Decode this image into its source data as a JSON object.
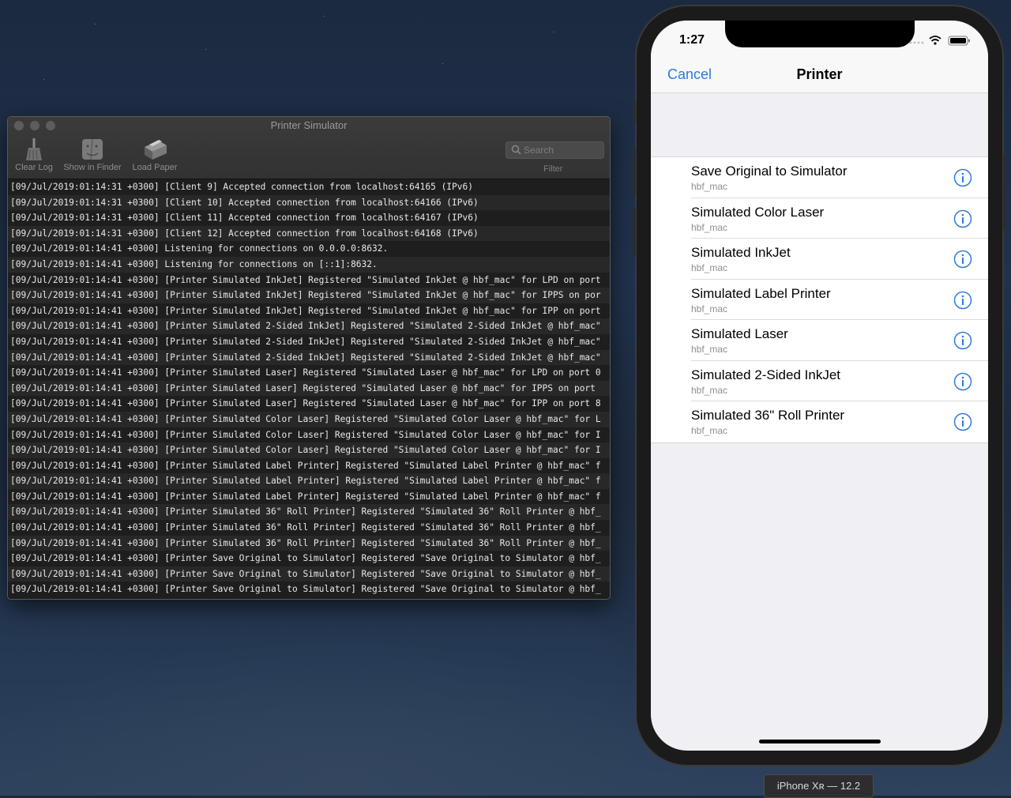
{
  "mac_window": {
    "title": "Printer Simulator",
    "toolbar": {
      "clear_log": "Clear Log",
      "show_in_finder": "Show in Finder",
      "load_paper": "Load Paper",
      "search_placeholder": "Search",
      "filter_label": "Filter"
    },
    "log_lines": [
      "[09/Jul/2019:01:14:31 +0300] [Client 9] Accepted connection from localhost:64165 (IPv6)",
      "[09/Jul/2019:01:14:31 +0300] [Client 10] Accepted connection from localhost:64166 (IPv6)",
      "[09/Jul/2019:01:14:31 +0300] [Client 11] Accepted connection from localhost:64167 (IPv6)",
      "[09/Jul/2019:01:14:31 +0300] [Client 12] Accepted connection from localhost:64168 (IPv6)",
      "[09/Jul/2019:01:14:41 +0300] Listening for connections on 0.0.0.0:8632.",
      "[09/Jul/2019:01:14:41 +0300] Listening for connections on [::1]:8632.",
      "[09/Jul/2019:01:14:41 +0300] [Printer Simulated InkJet] Registered \"Simulated InkJet @ hbf_mac\" for LPD on port",
      "[09/Jul/2019:01:14:41 +0300] [Printer Simulated InkJet] Registered \"Simulated InkJet @ hbf_mac\" for IPPS on por",
      "[09/Jul/2019:01:14:41 +0300] [Printer Simulated InkJet] Registered \"Simulated InkJet @ hbf_mac\" for IPP on port",
      "[09/Jul/2019:01:14:41 +0300] [Printer Simulated 2-Sided InkJet] Registered \"Simulated 2-Sided InkJet @ hbf_mac\"",
      "[09/Jul/2019:01:14:41 +0300] [Printer Simulated 2-Sided InkJet] Registered \"Simulated 2-Sided InkJet @ hbf_mac\"",
      "[09/Jul/2019:01:14:41 +0300] [Printer Simulated 2-Sided InkJet] Registered \"Simulated 2-Sided InkJet @ hbf_mac\"",
      "[09/Jul/2019:01:14:41 +0300] [Printer Simulated Laser] Registered \"Simulated Laser @ hbf_mac\" for LPD on port 0",
      "[09/Jul/2019:01:14:41 +0300] [Printer Simulated Laser] Registered \"Simulated Laser @ hbf_mac\" for IPPS on port",
      "[09/Jul/2019:01:14:41 +0300] [Printer Simulated Laser] Registered \"Simulated Laser @ hbf_mac\" for IPP on port 8",
      "[09/Jul/2019:01:14:41 +0300] [Printer Simulated Color Laser] Registered \"Simulated Color Laser @ hbf_mac\" for L",
      "[09/Jul/2019:01:14:41 +0300] [Printer Simulated Color Laser] Registered \"Simulated Color Laser @ hbf_mac\" for I",
      "[09/Jul/2019:01:14:41 +0300] [Printer Simulated Color Laser] Registered \"Simulated Color Laser @ hbf_mac\" for I",
      "[09/Jul/2019:01:14:41 +0300] [Printer Simulated Label Printer] Registered \"Simulated Label Printer @ hbf_mac\" f",
      "[09/Jul/2019:01:14:41 +0300] [Printer Simulated Label Printer] Registered \"Simulated Label Printer @ hbf_mac\" f",
      "[09/Jul/2019:01:14:41 +0300] [Printer Simulated Label Printer] Registered \"Simulated Label Printer @ hbf_mac\" f",
      "[09/Jul/2019:01:14:41 +0300] [Printer Simulated 36\" Roll Printer] Registered \"Simulated 36\" Roll Printer @ hbf_",
      "[09/Jul/2019:01:14:41 +0300] [Printer Simulated 36\" Roll Printer] Registered \"Simulated 36\" Roll Printer @ hbf_",
      "[09/Jul/2019:01:14:41 +0300] [Printer Simulated 36\" Roll Printer] Registered \"Simulated 36\" Roll Printer @ hbf_",
      "[09/Jul/2019:01:14:41 +0300] [Printer Save Original to Simulator] Registered \"Save Original to Simulator @ hbf_",
      "[09/Jul/2019:01:14:41 +0300] [Printer Save Original to Simulator] Registered \"Save Original to Simulator @ hbf_",
      "[09/Jul/2019:01:14:41 +0300] [Printer Save Original to Simulator] Registered \"Save Original to Simulator @ hbf_"
    ]
  },
  "phone": {
    "status_time": "1:27",
    "nav": {
      "cancel": "Cancel",
      "title": "Printer"
    },
    "printers": [
      {
        "name": "Save Original to Simulator",
        "host": "hbf_mac"
      },
      {
        "name": "Simulated Color Laser",
        "host": "hbf_mac"
      },
      {
        "name": "Simulated InkJet",
        "host": "hbf_mac"
      },
      {
        "name": "Simulated Label Printer",
        "host": "hbf_mac"
      },
      {
        "name": "Simulated Laser",
        "host": "hbf_mac"
      },
      {
        "name": "Simulated 2-Sided InkJet",
        "host": "hbf_mac"
      },
      {
        "name": "Simulated 36\" Roll Printer",
        "host": "hbf_mac"
      }
    ],
    "accent_color": "#2f7bd8"
  },
  "device_label": "iPhone Xʀ — 12.2"
}
